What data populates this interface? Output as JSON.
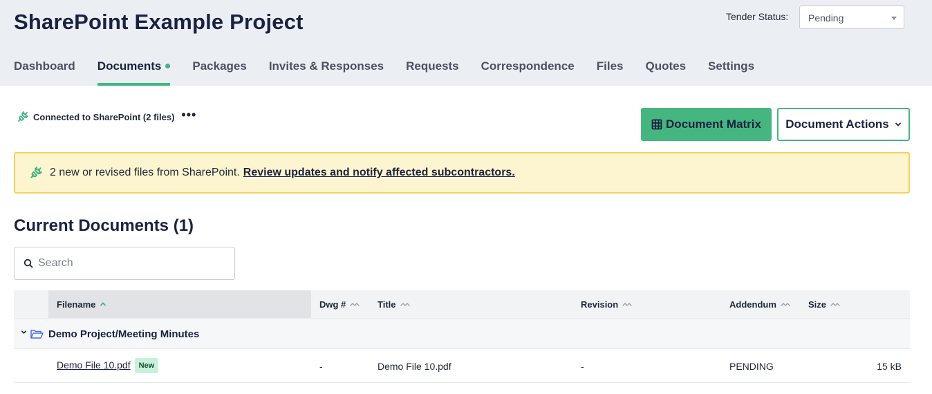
{
  "header": {
    "project_title": "SharePoint Example Project",
    "tender_status_label": "Tender Status:",
    "tender_status_value": "Pending"
  },
  "tabs": [
    {
      "label": "Dashboard"
    },
    {
      "label": "Documents",
      "active": true,
      "has_dot": true
    },
    {
      "label": "Packages"
    },
    {
      "label": "Invites & Responses"
    },
    {
      "label": "Requests"
    },
    {
      "label": "Correspondence"
    },
    {
      "label": "Files"
    },
    {
      "label": "Quotes"
    },
    {
      "label": "Settings"
    }
  ],
  "sharepoint": {
    "status_text": "Connected to SharePoint (2 files)",
    "more_label": "•••",
    "icon": "plug-sync-icon"
  },
  "toolbar": {
    "matrix_label": "Document Matrix",
    "actions_label": "Document Actions"
  },
  "banner": {
    "text": "2 new or revised files from SharePoint.",
    "link": "Review updates and notify affected subcontractors."
  },
  "documents": {
    "title": "Current Documents (1)",
    "search_placeholder": "Search",
    "columns": [
      {
        "label": "Filename",
        "sort": "asc"
      },
      {
        "label": "Dwg #"
      },
      {
        "label": "Title"
      },
      {
        "label": "Revision"
      },
      {
        "label": "Addendum"
      },
      {
        "label": "Size"
      }
    ],
    "groups": [
      {
        "name": "Demo Project/Meeting Minutes",
        "rows": [
          {
            "filename": "Demo File 10.pdf",
            "badge": "New",
            "dwg": "-",
            "title": "Demo File 10.pdf",
            "revision": "-",
            "addendum": "PENDING",
            "size": "15 kB"
          }
        ]
      }
    ]
  },
  "colors": {
    "accent_green": "#46b681",
    "header_bg": "#ebeff3",
    "banner_bg": "#fdf5cf",
    "banner_border": "#f3d35f",
    "title_navy": "#1a2241"
  }
}
